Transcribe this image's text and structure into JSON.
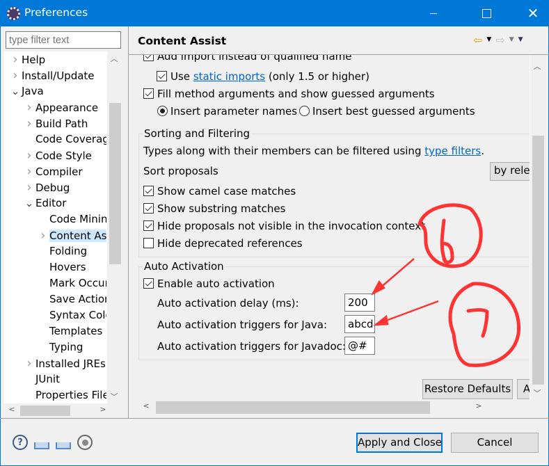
{
  "window": {
    "title": "Preferences",
    "minimize_glyph": "",
    "close_glyph": "✕"
  },
  "sidebar": {
    "filter_placeholder": "type filter text",
    "items": [
      {
        "label": "Help",
        "level": 0,
        "twisty": "collapsed"
      },
      {
        "label": "Install/Update",
        "level": 0,
        "twisty": "collapsed"
      },
      {
        "label": "Java",
        "level": 0,
        "twisty": "expanded"
      },
      {
        "label": "Appearance",
        "level": 1,
        "twisty": "collapsed"
      },
      {
        "label": "Build Path",
        "level": 1,
        "twisty": "collapsed"
      },
      {
        "label": "Code Coverage",
        "level": 1,
        "twisty": "none"
      },
      {
        "label": "Code Style",
        "level": 1,
        "twisty": "collapsed"
      },
      {
        "label": "Compiler",
        "level": 1,
        "twisty": "collapsed"
      },
      {
        "label": "Debug",
        "level": 1,
        "twisty": "collapsed"
      },
      {
        "label": "Editor",
        "level": 1,
        "twisty": "expanded"
      },
      {
        "label": "Code Minings",
        "level": 2,
        "twisty": "none"
      },
      {
        "label": "Content Assist",
        "level": 2,
        "twisty": "collapsed",
        "selected": true
      },
      {
        "label": "Folding",
        "level": 2,
        "twisty": "none"
      },
      {
        "label": "Hovers",
        "level": 2,
        "twisty": "none"
      },
      {
        "label": "Mark Occurrences",
        "level": 2,
        "twisty": "none"
      },
      {
        "label": "Save Actions",
        "level": 2,
        "twisty": "none"
      },
      {
        "label": "Syntax Coloring",
        "level": 2,
        "twisty": "none"
      },
      {
        "label": "Templates",
        "level": 2,
        "twisty": "none"
      },
      {
        "label": "Typing",
        "level": 2,
        "twisty": "none"
      },
      {
        "label": "Installed JREs",
        "level": 1,
        "twisty": "collapsed"
      },
      {
        "label": "JUnit",
        "level": 1,
        "twisty": "none"
      },
      {
        "label": "Properties Files Editor",
        "level": 1,
        "twisty": "none"
      }
    ]
  },
  "page": {
    "title": "Content Assist",
    "partial_top_row": "Add import instead of qualified name",
    "use_static_imports": {
      "prefix": "Use",
      "link": "static imports",
      "suffix": "(only 1.5 or higher)",
      "checked": true
    },
    "fill_method_args": {
      "label": "Fill method arguments and show guessed arguments",
      "checked": true
    },
    "radio_insert_param_names": {
      "label": "Insert parameter names",
      "checked": true
    },
    "radio_insert_best_guessed": {
      "label": "Insert best guessed arguments",
      "checked": false
    },
    "sorting": {
      "group_title": "Sorting and Filtering",
      "description_prefix": "Types along with their members can be filtered using",
      "description_link": "type filters",
      "description_suffix": ".",
      "sort_label": "Sort proposals",
      "sort_value": "by relevance",
      "options": [
        {
          "label": "Show camel case matches",
          "checked": true
        },
        {
          "label": "Show substring matches",
          "checked": true
        },
        {
          "label": "Hide proposals not visible in the invocation context",
          "checked": true
        },
        {
          "label": "Hide deprecated references",
          "checked": false
        }
      ]
    },
    "auto_activation": {
      "group_title": "Auto Activation",
      "enable_label": "Enable auto activation",
      "enabled": true,
      "delay_label": "Auto activation delay (ms):",
      "delay_value": "200",
      "java_triggers_label": "Auto activation triggers for Java:",
      "java_triggers_value": "abcd",
      "javadoc_triggers_label": "Auto activation triggers for Javadoc:",
      "javadoc_triggers_value": "@#"
    },
    "restore_defaults_label": "Restore Defaults",
    "apply_label": "Apply"
  },
  "footer": {
    "apply_close_label": "Apply and Close",
    "cancel_label": "Cancel",
    "help_glyph": "?"
  },
  "annotations": {
    "color": "#ff3333",
    "marks": [
      "6",
      "7"
    ]
  }
}
